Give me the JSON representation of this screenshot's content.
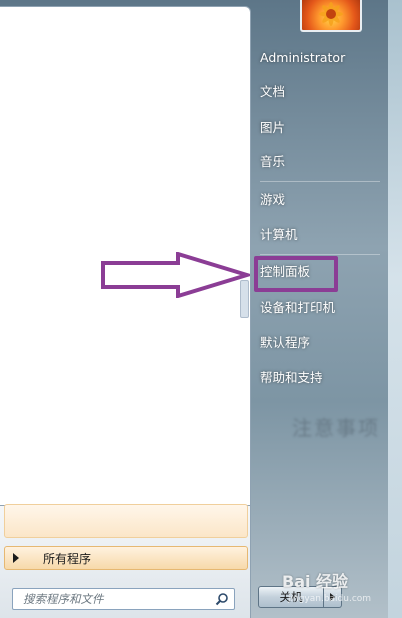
{
  "start_menu": {
    "user_name": "Administrator",
    "right_items": [
      {
        "label": "文档"
      },
      {
        "label": "图片"
      },
      {
        "label": "音乐"
      },
      {
        "label": "游戏"
      },
      {
        "label": "计算机"
      },
      {
        "label": "控制面板"
      },
      {
        "label": "设备和打印机"
      },
      {
        "label": "默认程序"
      },
      {
        "label": "帮助和支持"
      }
    ],
    "all_programs_label": "所有程序",
    "search_placeholder": "搜索程序和文件",
    "shutdown_label": "关机",
    "highlighted_item": "控制面板"
  },
  "annotation": {
    "arrow_color": "#8b3d95",
    "highlight_color": "#8b3d95"
  },
  "background": {
    "blurred_text": "注意事项",
    "watermark": "Bai 经验",
    "watermark_url": "jingyan.baidu.com"
  },
  "icons": [
    "search-icon",
    "user-avatar-flower-icon",
    "all-programs-arrow-icon",
    "shutdown-arrow-icon"
  ]
}
